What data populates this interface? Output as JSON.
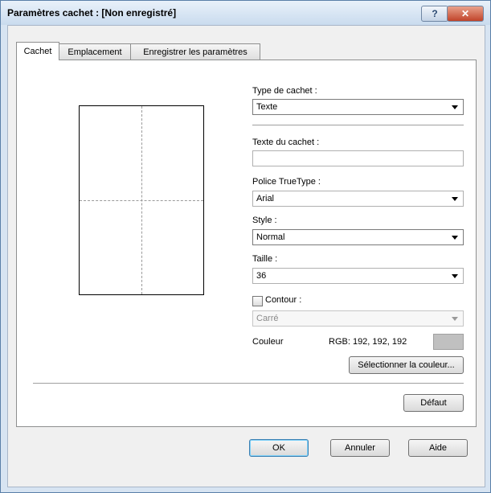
{
  "window": {
    "title": "Paramètres cachet : [Non enregistré]"
  },
  "titlebar": {
    "help_glyph": "?",
    "close_glyph": "✕"
  },
  "tabs": [
    {
      "label": "Cachet",
      "active": true
    },
    {
      "label": "Emplacement",
      "active": false
    },
    {
      "label": "Enregistrer les paramètres",
      "active": false
    }
  ],
  "stamp": {
    "type_label": "Type de cachet :",
    "type_value": "Texte",
    "text_label": "Texte du cachet :",
    "text_value": "",
    "font_label": "Police TrueType :",
    "font_value": "Arial",
    "style_label": "Style :",
    "style_value": "Normal",
    "size_label": "Taille :",
    "size_value": "36",
    "outline_label": "Contour :",
    "outline_checked": false,
    "outline_value": "Carré",
    "color_label": "Couleur",
    "color_rgb": "RGB: 192, 192, 192",
    "color_swatch": "#c0c0c0",
    "select_color_label": "Sélectionner la couleur..."
  },
  "buttons": {
    "default_label": "Défaut",
    "ok_label": "OK",
    "cancel_label": "Annuler",
    "help_label": "Aide"
  }
}
